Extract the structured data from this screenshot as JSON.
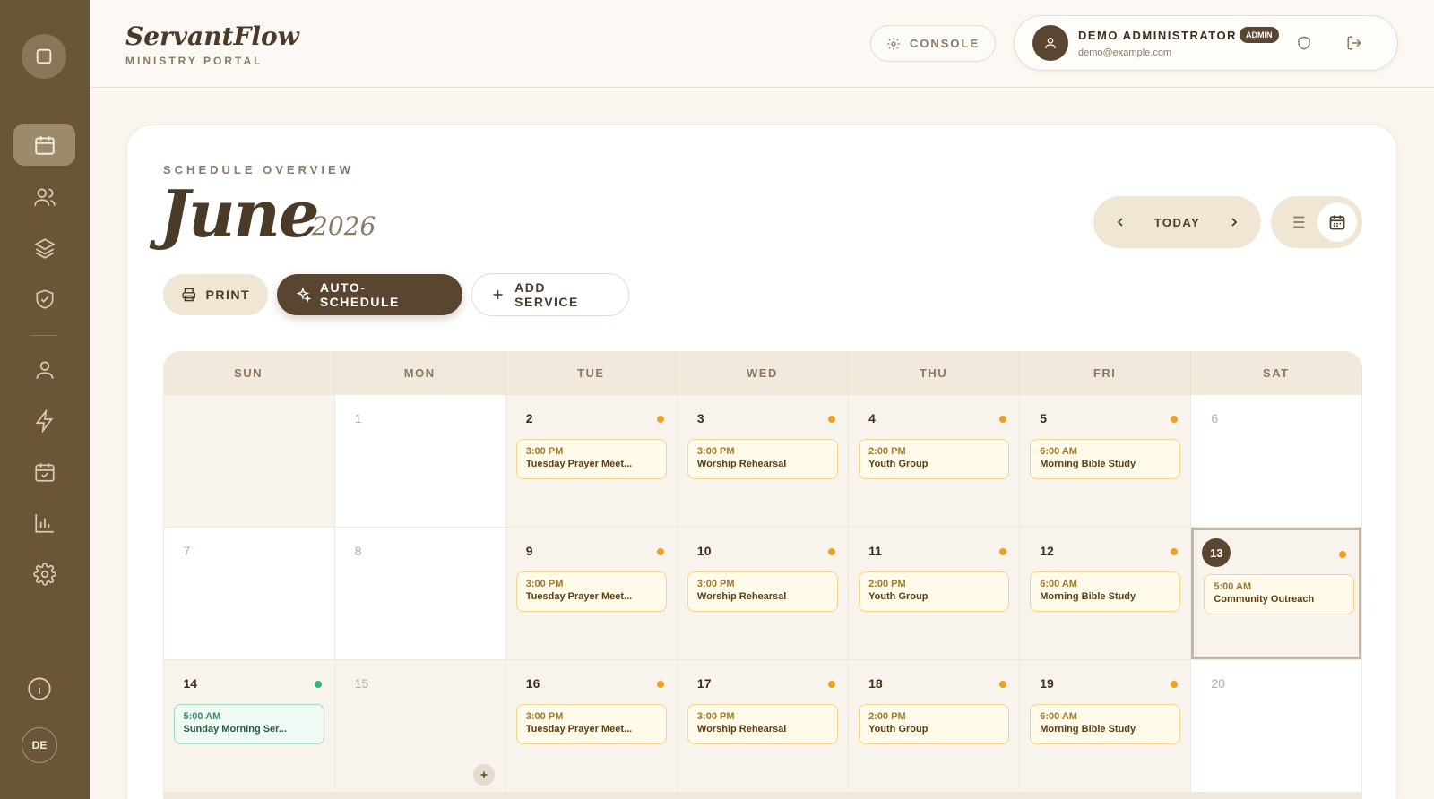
{
  "brand": {
    "name": "ServantFlow",
    "subtitle": "MINISTRY PORTAL"
  },
  "sidebar": {
    "avatar_initials": "DE",
    "items": [
      {
        "icon": "calendar-icon",
        "active": true
      },
      {
        "icon": "users-icon"
      },
      {
        "icon": "layers-icon"
      },
      {
        "icon": "shield-check-icon"
      },
      {
        "icon": "user-icon"
      },
      {
        "icon": "lightning-icon"
      },
      {
        "icon": "calendar-check-icon"
      },
      {
        "icon": "bar-chart-icon"
      },
      {
        "icon": "gear-icon"
      }
    ]
  },
  "header": {
    "console_label": "CONSOLE",
    "user": {
      "name": "DEMO ADMINISTRATOR",
      "badge": "ADMIN",
      "email": "demo@example.com"
    }
  },
  "schedule": {
    "overview_label": "SCHEDULE OVERVIEW",
    "month": "June",
    "year": "2026",
    "today_label": "TODAY",
    "buttons": {
      "print": "PRINT",
      "auto": "AUTO-SCHEDULE",
      "add": "ADD SERVICE"
    }
  },
  "calendar": {
    "weekdays": [
      "SUN",
      "MON",
      "TUE",
      "WED",
      "THU",
      "FRI",
      "SAT"
    ],
    "rows": [
      [
        {
          "day": "",
          "white": false
        },
        {
          "day": "1",
          "muted": true,
          "white": true
        },
        {
          "day": "2",
          "dot": "amber",
          "event": {
            "time": "3:00 PM",
            "title": "Tuesday Prayer Meet..."
          }
        },
        {
          "day": "3",
          "dot": "amber",
          "event": {
            "time": "3:00 PM",
            "title": "Worship Rehearsal"
          }
        },
        {
          "day": "4",
          "dot": "amber",
          "event": {
            "time": "2:00 PM",
            "title": "Youth Group"
          }
        },
        {
          "day": "5",
          "dot": "amber",
          "event": {
            "time": "6:00 AM",
            "title": "Morning Bible Study"
          }
        },
        {
          "day": "6",
          "muted": true,
          "white": true
        }
      ],
      [
        {
          "day": "7",
          "muted": true,
          "white": true
        },
        {
          "day": "8",
          "muted": true,
          "white": true
        },
        {
          "day": "9",
          "dot": "amber",
          "event": {
            "time": "3:00 PM",
            "title": "Tuesday Prayer Meet..."
          }
        },
        {
          "day": "10",
          "dot": "amber",
          "event": {
            "time": "3:00 PM",
            "title": "Worship Rehearsal"
          }
        },
        {
          "day": "11",
          "dot": "amber",
          "event": {
            "time": "2:00 PM",
            "title": "Youth Group"
          }
        },
        {
          "day": "12",
          "dot": "amber",
          "event": {
            "time": "6:00 AM",
            "title": "Morning Bible Study"
          }
        },
        {
          "day": "13",
          "today": true,
          "dot": "amber",
          "event": {
            "time": "5:00 AM",
            "title": "Community Outreach"
          }
        }
      ],
      [
        {
          "day": "14",
          "dot": "green",
          "event": {
            "time": "5:00 AM",
            "title": "Sunday Morning Ser...",
            "green": true
          }
        },
        {
          "day": "15",
          "muted": true,
          "add": true
        },
        {
          "day": "16",
          "dot": "amber",
          "event": {
            "time": "3:00 PM",
            "title": "Tuesday Prayer Meet..."
          }
        },
        {
          "day": "17",
          "dot": "amber",
          "event": {
            "time": "3:00 PM",
            "title": "Worship Rehearsal"
          }
        },
        {
          "day": "18",
          "dot": "amber",
          "event": {
            "time": "2:00 PM",
            "title": "Youth Group"
          }
        },
        {
          "day": "19",
          "dot": "amber",
          "event": {
            "time": "6:00 AM",
            "title": "Morning Bible Study"
          }
        },
        {
          "day": "20",
          "muted": true,
          "white": true
        }
      ]
    ]
  }
}
